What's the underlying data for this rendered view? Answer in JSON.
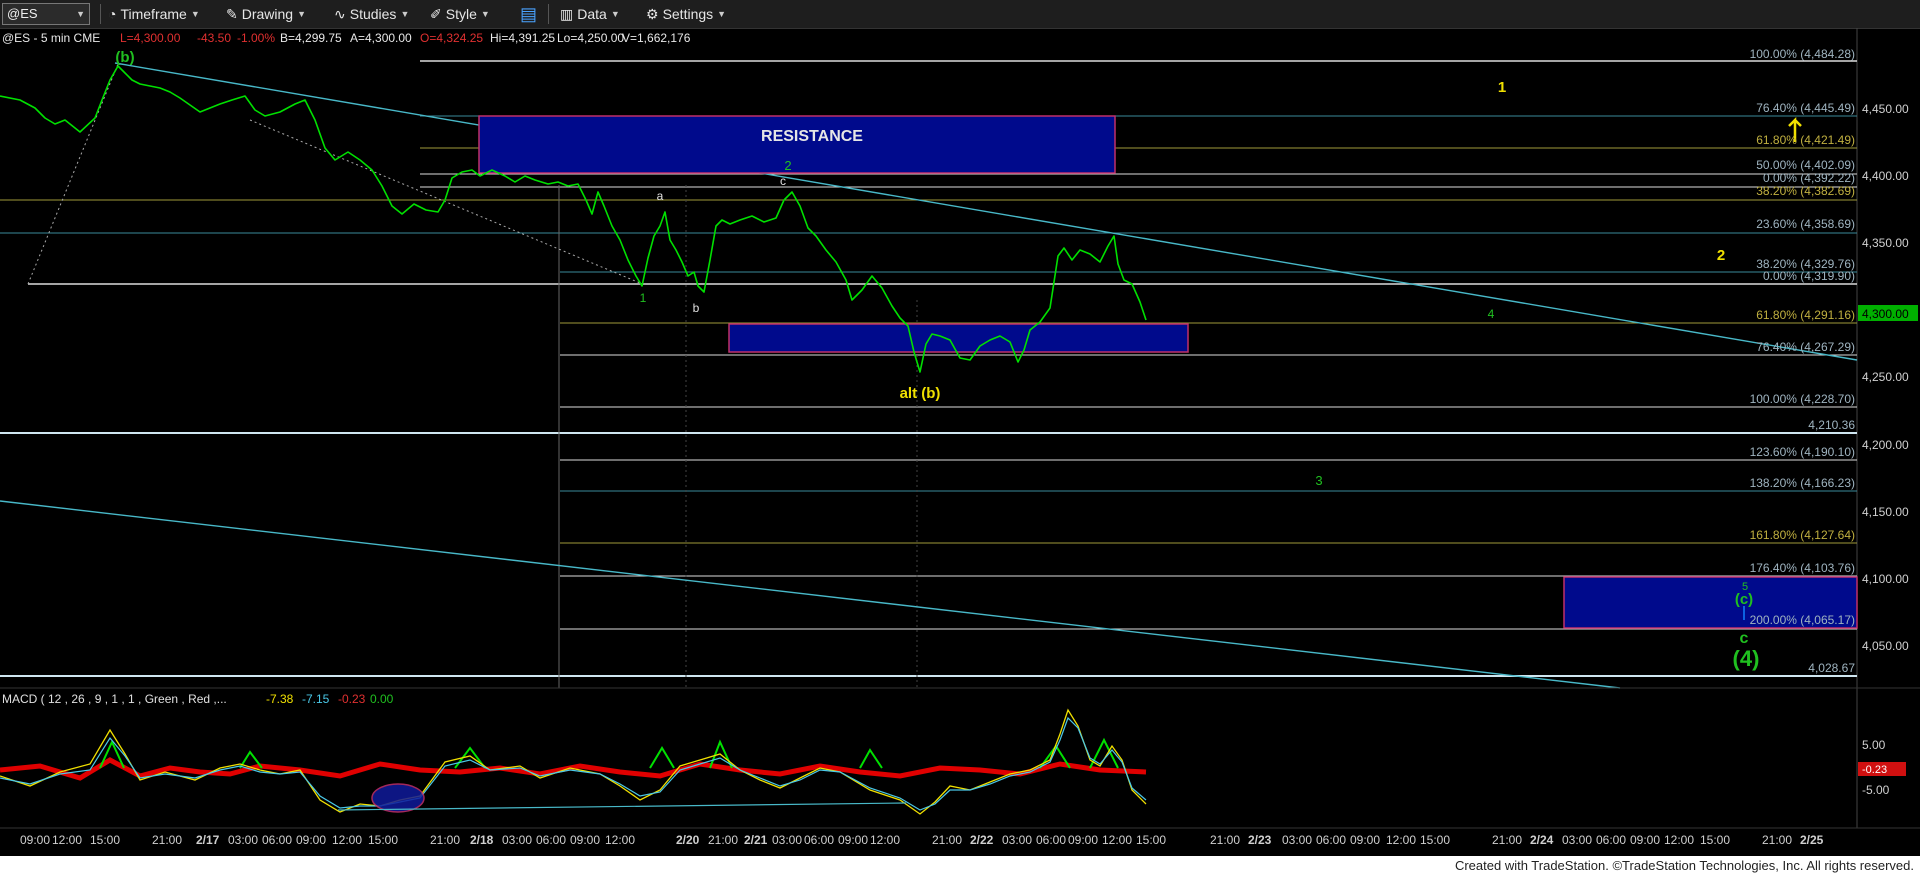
{
  "toolbar": {
    "symbol": "@ES",
    "timeframe": "Timeframe",
    "drawing": "Drawing",
    "studies": "Studies",
    "style": "Style",
    "data": "Data",
    "settings": "Settings"
  },
  "header": {
    "symbol_info": "@ES - 5 min  CME",
    "last": "L=4,300.00",
    "change": "-43.50",
    "pct": "-1.00%",
    "bid": "B=4,299.75",
    "ask": "A=4,300.00",
    "open": "O=4,324.25",
    "hi": "Hi=4,391.25",
    "lo": "Lo=4,250.00",
    "vol": "V=1,662,176"
  },
  "price_axis": {
    "labels": [
      "4,450.00",
      "4,400.00",
      "4,350.00",
      "4,300.00",
      "4,250.00",
      "4,200.00",
      "4,150.00",
      "4,100.00",
      "4,050.00"
    ],
    "current": "4,300.00"
  },
  "fib_labels": [
    "100.00% (4,484.28)",
    "76.40% (4,445.49)",
    "61.80% (4,421.49)",
    "50.00% (4,402.09)",
    "0.00% (4,392.22)",
    "38.20% (4,382.69)",
    "23.60% (4,358.69)",
    "38.20% (4,329.76)",
    "0.00% (4,319.90)",
    "61.80% (4,291.16)",
    "76.40% (4,267.29)",
    "100.00% (4,228.70)",
    "4,210.36",
    "123.60% (4,190.10)",
    "138.20% (4,166.23)",
    "161.80% (4,127.64)",
    "176.40% (4,103.76)",
    "200.00% (4,065.17)",
    "4,028.67"
  ],
  "annotations": {
    "resistance": "RESISTANCE",
    "alt_b": "alt (b)",
    "b_top": "(b)",
    "wave_1": "1",
    "wave_2": "2",
    "wave_3": "3",
    "wave_4": "4",
    "wave_5": "5",
    "wave_a": "a",
    "wave_b": "b",
    "wave_c": "c",
    "c_paren": "(c)",
    "c_small": "c",
    "four_paren": "(4)"
  },
  "macd": {
    "label": "MACD ( 12 , 26 , 9 , 1 , 1 , Green , Red ,...",
    "v1": "-7.38",
    "v2": "-7.15",
    "v3": "-0.23",
    "v4": "0.00",
    "axis_top": "5.00",
    "axis_bottom": "-5.00",
    "axis_current": "-0.23"
  },
  "time_axis": [
    "09:00",
    "12:00",
    "15:00",
    "21:00",
    "2/17",
    "03:00",
    "06:00",
    "09:00",
    "12:00",
    "15:00",
    "21:00",
    "2/18",
    "03:00",
    "06:00",
    "09:00",
    "12:00",
    "2/20",
    "21:00",
    "2/21",
    "03:00",
    "06:00",
    "09:00",
    "12:00",
    "21:00",
    "2/22",
    "03:00",
    "06:00",
    "09:00",
    "12:00",
    "15:00",
    "21:00",
    "2/23",
    "03:00",
    "06:00",
    "09:00",
    "12:00",
    "15:00",
    "21:00",
    "2/24",
    "03:00",
    "06:00",
    "09:00",
    "12:00",
    "15:00",
    "21:00",
    "2/25"
  ],
  "footer": "Created with TradeStation. ©TradeStation Technologies, Inc. All rights reserved.",
  "colors": {
    "price": "#00e000",
    "fib_label": "#9ab",
    "resistance_box": "#000a8c",
    "trend": "#48b8c8",
    "yellow": "#f0e000",
    "macd_hist_up": "#00e000",
    "macd_hist_down": "#e00000"
  }
}
